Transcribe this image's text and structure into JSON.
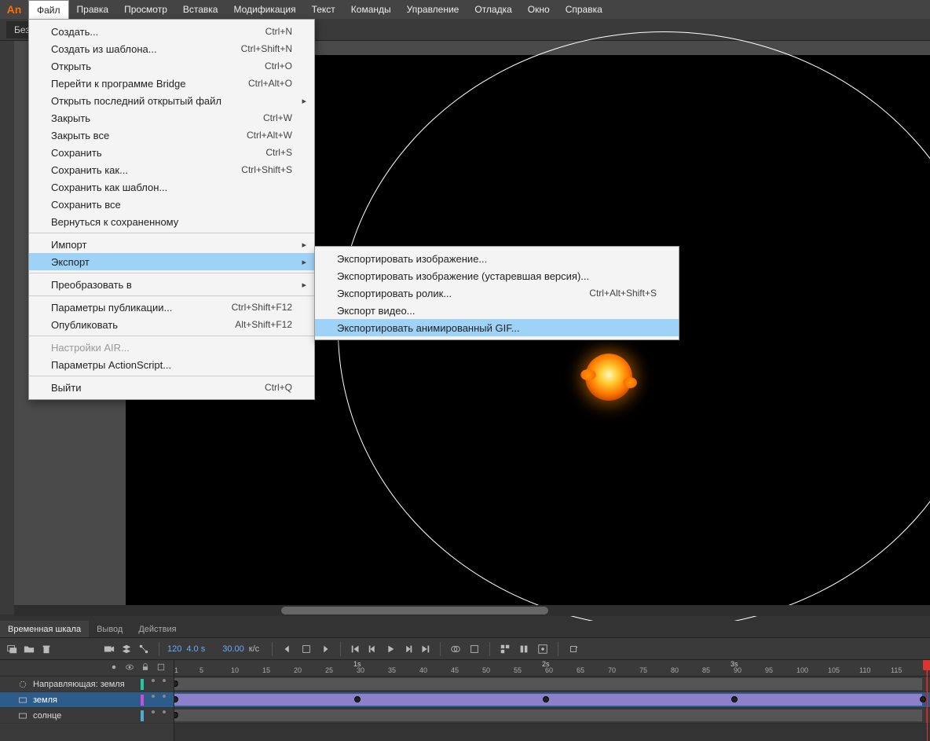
{
  "brand": "An",
  "menubar": [
    "Файл",
    "Правка",
    "Просмотр",
    "Вставка",
    "Модификация",
    "Текст",
    "Команды",
    "Управление",
    "Отладка",
    "Окно",
    "Справка"
  ],
  "doc_tab": "Безым",
  "file_menu": {
    "groups": [
      [
        {
          "label": "Создать...",
          "shortcut": "Ctrl+N"
        },
        {
          "label": "Создать из шаблона...",
          "shortcut": "Ctrl+Shift+N"
        },
        {
          "label": "Открыть",
          "shortcut": "Ctrl+O"
        },
        {
          "label": "Перейти к программе Bridge",
          "shortcut": "Ctrl+Alt+O"
        },
        {
          "label": "Открыть последний открытый файл",
          "submenu": true
        },
        {
          "label": "Закрыть",
          "shortcut": "Ctrl+W"
        },
        {
          "label": "Закрыть все",
          "shortcut": "Ctrl+Alt+W"
        },
        {
          "label": "Сохранить",
          "shortcut": "Ctrl+S"
        },
        {
          "label": "Сохранить как...",
          "shortcut": "Ctrl+Shift+S"
        },
        {
          "label": "Сохранить как шаблон..."
        },
        {
          "label": "Сохранить все"
        },
        {
          "label": "Вернуться к сохраненному"
        }
      ],
      [
        {
          "label": "Импорт",
          "submenu": true
        },
        {
          "label": "Экспорт",
          "submenu": true,
          "highlight": true
        }
      ],
      [
        {
          "label": "Преобразовать в",
          "submenu": true
        }
      ],
      [
        {
          "label": "Параметры публикации...",
          "shortcut": "Ctrl+Shift+F12"
        },
        {
          "label": "Опубликовать",
          "shortcut": "Alt+Shift+F12"
        }
      ],
      [
        {
          "label": "Настройки AIR...",
          "disabled": true
        },
        {
          "label": "Параметры ActionScript..."
        }
      ],
      [
        {
          "label": "Выйти",
          "shortcut": "Ctrl+Q"
        }
      ]
    ]
  },
  "export_submenu": [
    {
      "label": "Экспортировать изображение..."
    },
    {
      "label": "Экспортировать изображение (устаревшая версия)..."
    },
    {
      "label": "Экспортировать ролик...",
      "shortcut": "Ctrl+Alt+Shift+S"
    },
    {
      "label": "Экспорт видео..."
    },
    {
      "label": "Экспортировать анимированный GIF...",
      "highlight": true
    }
  ],
  "timeline": {
    "tabs": [
      "Временная шкала",
      "Вывод",
      "Действия"
    ],
    "frame_num": "120",
    "time": "4.0 s",
    "fps_num": "30.00",
    "fps_unit": "к/с",
    "ruler_ticks": [
      1,
      5,
      10,
      15,
      20,
      25,
      30,
      35,
      40,
      45,
      50,
      55,
      60,
      65,
      70,
      75,
      80,
      85,
      90,
      95,
      100,
      105,
      110,
      115
    ],
    "ruler_secs": [
      {
        "label": "1s",
        "frame": 30
      },
      {
        "label": "2s",
        "frame": 60
      },
      {
        "label": "3s",
        "frame": 90
      }
    ],
    "layers": [
      {
        "name": "Направляющая: земля",
        "type": "guide",
        "color": "#1fc9a3"
      },
      {
        "name": "земля",
        "type": "normal",
        "color": "#c84fd6",
        "selected": true,
        "tween": true
      },
      {
        "name": "солнце",
        "type": "normal",
        "color": "#4fa8d6"
      }
    ]
  }
}
